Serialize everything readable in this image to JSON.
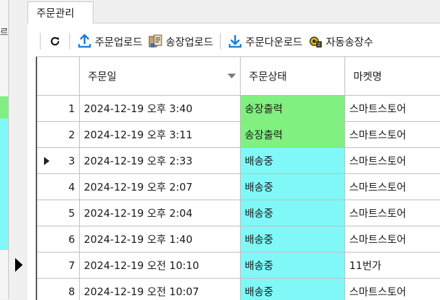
{
  "left_panel": {
    "partial_label": "르"
  },
  "tab": {
    "label": "주문관리"
  },
  "toolbar": {
    "buttons": [
      {
        "label": "",
        "icon": "refresh-icon"
      },
      {
        "label": "주문업로드",
        "icon": "upload-icon"
      },
      {
        "label": "송장업로드",
        "icon": "invoice-upload-icon"
      },
      {
        "label": "주문다운로드",
        "icon": "download-icon"
      },
      {
        "label": "자동송장수",
        "icon": "auto-invoice-icon"
      }
    ]
  },
  "grid": {
    "columns": [
      "",
      "주문일",
      "주문상태",
      "마켓명"
    ],
    "sorted_column": "주문일",
    "status_colors": {
      "송장출력": "#80f080",
      "배송중": "#80f8f8"
    },
    "rows": [
      {
        "no": "1",
        "date": "2024-12-19 오후 3:40",
        "status": "송장출력",
        "market": "스마트스토어"
      },
      {
        "no": "2",
        "date": "2024-12-19 오후 3:11",
        "status": "송장출력",
        "market": "스마트스토어"
      },
      {
        "no": "3",
        "date": "2024-12-19 오후 2:33",
        "status": "배송중",
        "market": "스마트스토어",
        "current": true
      },
      {
        "no": "4",
        "date": "2024-12-19 오후 2:07",
        "status": "배송중",
        "market": "스마트스토어"
      },
      {
        "no": "5",
        "date": "2024-12-19 오후 2:04",
        "status": "배송중",
        "market": "스마트스토어"
      },
      {
        "no": "6",
        "date": "2024-12-19 오후 1:40",
        "status": "배송중",
        "market": "스마트스토어"
      },
      {
        "no": "7",
        "date": "2024-12-19 오전 10:10",
        "status": "배송중",
        "market": "11번가"
      },
      {
        "no": "8",
        "date": "2024-12-19 오전 10:07",
        "status": "배송중",
        "market": "스마트스토어"
      }
    ]
  }
}
